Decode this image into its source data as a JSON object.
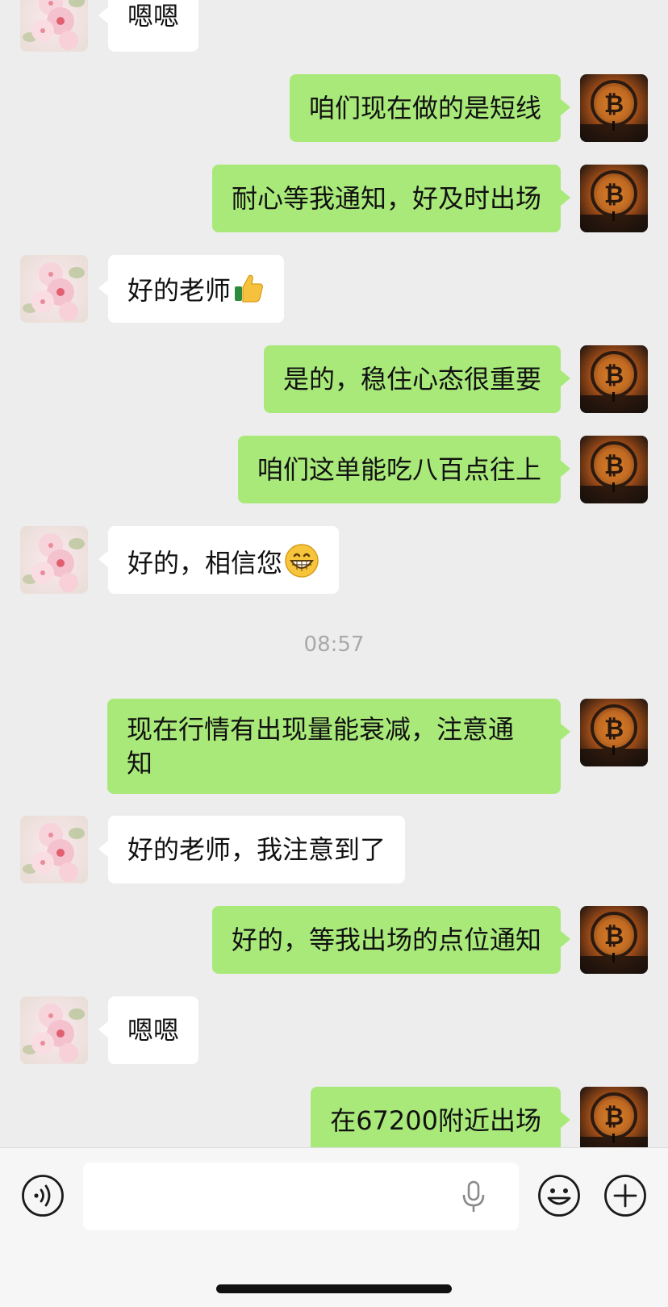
{
  "conversation": {
    "timestamp": "08:57",
    "messages": [
      {
        "side": "in",
        "text": "嗯嗯"
      },
      {
        "side": "out",
        "text": "咱们现在做的是短线"
      },
      {
        "side": "out",
        "text": "耐心等我通知，好及时出场"
      },
      {
        "side": "in",
        "text": "好的老师",
        "emoji": "thumbs-up"
      },
      {
        "side": "out",
        "text": "是的，稳住心态很重要"
      },
      {
        "side": "out",
        "text": "咱们这单能吃八百点往上"
      },
      {
        "side": "in",
        "text": "好的，相信您",
        "emoji": "grinning-face"
      },
      {
        "side": "out",
        "text_line1": "现在行情有出现量能衰减，注意通",
        "text_line2": "知"
      },
      {
        "side": "in",
        "text": "好的老师，我注意到了"
      },
      {
        "side": "out",
        "text": "好的，等我出场的点位通知"
      },
      {
        "side": "in",
        "text": "嗯嗯"
      },
      {
        "side": "out",
        "text": "在67200附近出场"
      }
    ]
  },
  "input_bar": {
    "icons": [
      "voice-icon",
      "microphone-icon",
      "emoji-icon",
      "plus-icon"
    ]
  },
  "colors": {
    "background": "#ededed",
    "outgoing_bubble": "#a9e97a",
    "incoming_bubble": "#ffffff",
    "timestamp_text": "#a9a9a9"
  }
}
